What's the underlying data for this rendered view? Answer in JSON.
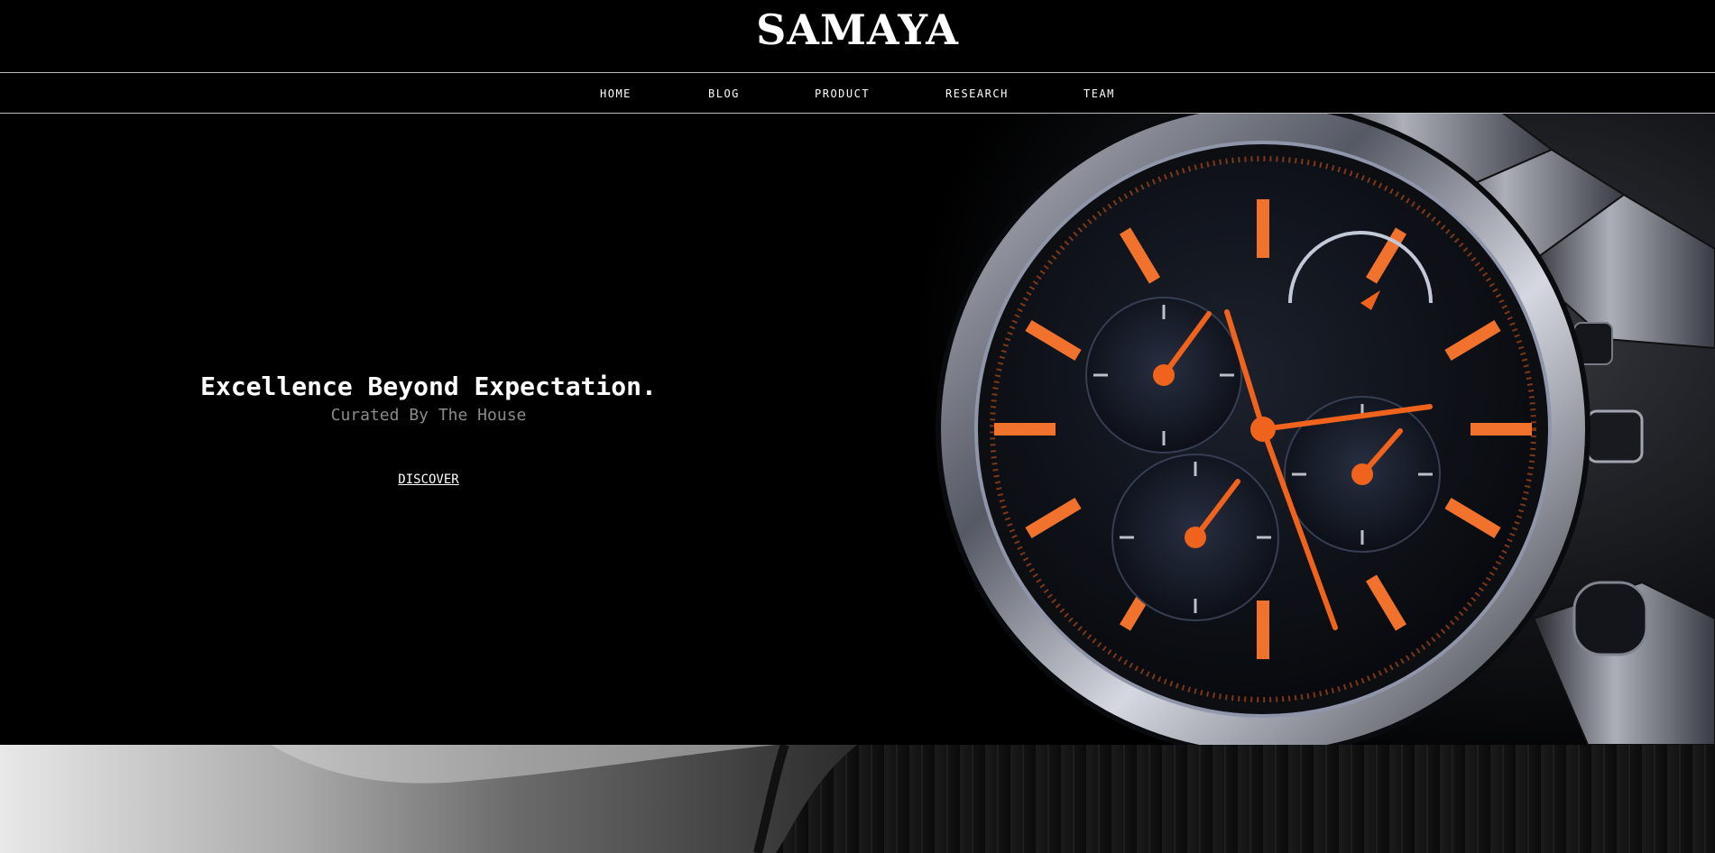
{
  "brand": {
    "name": "SAMAYA"
  },
  "nav": {
    "items": [
      {
        "label": "HOME"
      },
      {
        "label": "BLOG"
      },
      {
        "label": "PRODUCT"
      },
      {
        "label": "RESEARCH"
      },
      {
        "label": "TEAM"
      }
    ]
  },
  "hero": {
    "headline": "Excellence Beyond Expectation.",
    "subline": "Curated By The House",
    "cta_label": "DISCOVER"
  },
  "colors": {
    "background": "#000000",
    "accent": "#ff6a1f",
    "subline": "#8a8a8a",
    "divider": "#bdbdbd"
  },
  "images": {
    "hero_image": "chronograph-watch-photo",
    "bottom_image": "wrist-and-suit-photo"
  }
}
